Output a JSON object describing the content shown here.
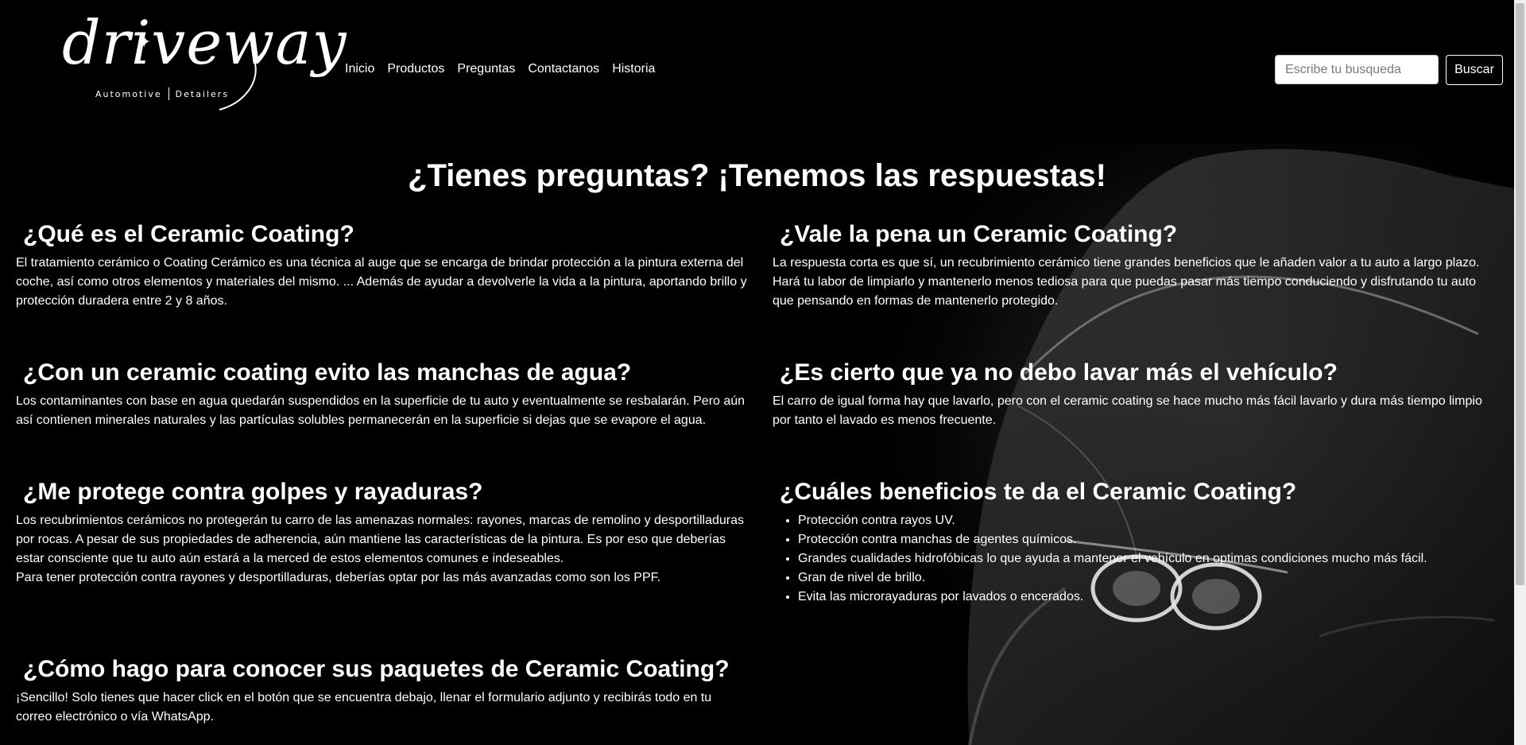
{
  "brand": {
    "logo_script": "driveway",
    "logo_left": "Automotive",
    "logo_right": "Detailers"
  },
  "nav": {
    "items": [
      {
        "label": "Inicio"
      },
      {
        "label": "Productos"
      },
      {
        "label": "Preguntas"
      },
      {
        "label": "Contactanos"
      },
      {
        "label": "Historia"
      }
    ]
  },
  "search": {
    "placeholder": "Escribe tu busqueda",
    "value": "",
    "button_label": "Buscar"
  },
  "main": {
    "title": "¿Tienes preguntas? ¡Tenemos las respuestas!",
    "faqs": [
      {
        "question": "¿Qué es el Ceramic Coating?",
        "answer": "El tratamiento cerámico o Coating Cerámico es una técnica al auge que se encarga de brindar protección a la pintura externa del coche, así como otros elementos y materiales del mismo. ... Además de ayudar a devolverle la vida a la pintura, aportando brillo y protección duradera entre 2 y 8 años."
      },
      {
        "question": "¿Vale la pena un Ceramic Coating?",
        "answer": "La respuesta corta es que sí, un recubrimiento cerámico tiene grandes beneficios que le añaden valor a tu auto a largo plazo. Hará tu labor de limpiarlo y mantenerlo menos tediosa para que puedas pasar más tiempo conduciendo y disfrutando tu auto que pensando en formas de mantenerlo protegido."
      },
      {
        "question": "¿Con un ceramic coating evito las manchas de agua?",
        "answer": "Los contaminantes con base en agua quedarán suspendidos en la superficie de tu auto y eventualmente se resbalarán. Pero aún así contienen minerales naturales y las partículas solubles permanecerán en la superficie si dejas que se evapore el agua."
      },
      {
        "question": "¿Es cierto que ya no debo lavar más el vehículo?",
        "answer": "El carro de igual forma hay que lavarlo, pero con el ceramic coating se hace mucho más fácil lavarlo y dura más tiempo limpio por tanto el lavado es menos frecuente."
      },
      {
        "question": "¿Me protege contra golpes y rayaduras?",
        "answer": "Los recubrimientos cerámicos no protegerán tu carro de las amenazas normales: rayones, marcas de remolino y desportilladuras por rocas. A pesar de sus propiedades de adherencia, aún mantiene las características de la pintura. Es por eso que deberías estar consciente que tu auto aún estará a la merced de estos elementos comunes e indeseables.",
        "answer2": "Para tener protección contra rayones y desportilladuras, deberías optar por las más avanzadas como son los PPF."
      },
      {
        "question": "¿Cuáles beneficios te da el Ceramic Coating?",
        "benefits": [
          "Protección contra rayos UV.",
          "Protección contra manchas de agentes químicos.",
          "Grandes cualidades hidrofóbicas lo que ayuda a mantener el vehículo en optimas condiciones mucho más fácil.",
          "Gran de nivel de brillo.",
          "Evita las microrayaduras por lavados o encerados."
        ]
      },
      {
        "question": "¿Cómo hago para conocer sus paquetes de Ceramic Coating?",
        "answer": "¡Sencillo! Solo tienes que hacer click en el botón que se encuentra debajo, llenar el formulario adjunto y recibirás todo en tu correo electrónico o vía WhatsApp."
      }
    ]
  },
  "colors": {
    "background": "#000000",
    "text": "#ffffff",
    "scrollbar_track": "#f1f1f1",
    "scrollbar_thumb": "#c1c1c1"
  }
}
